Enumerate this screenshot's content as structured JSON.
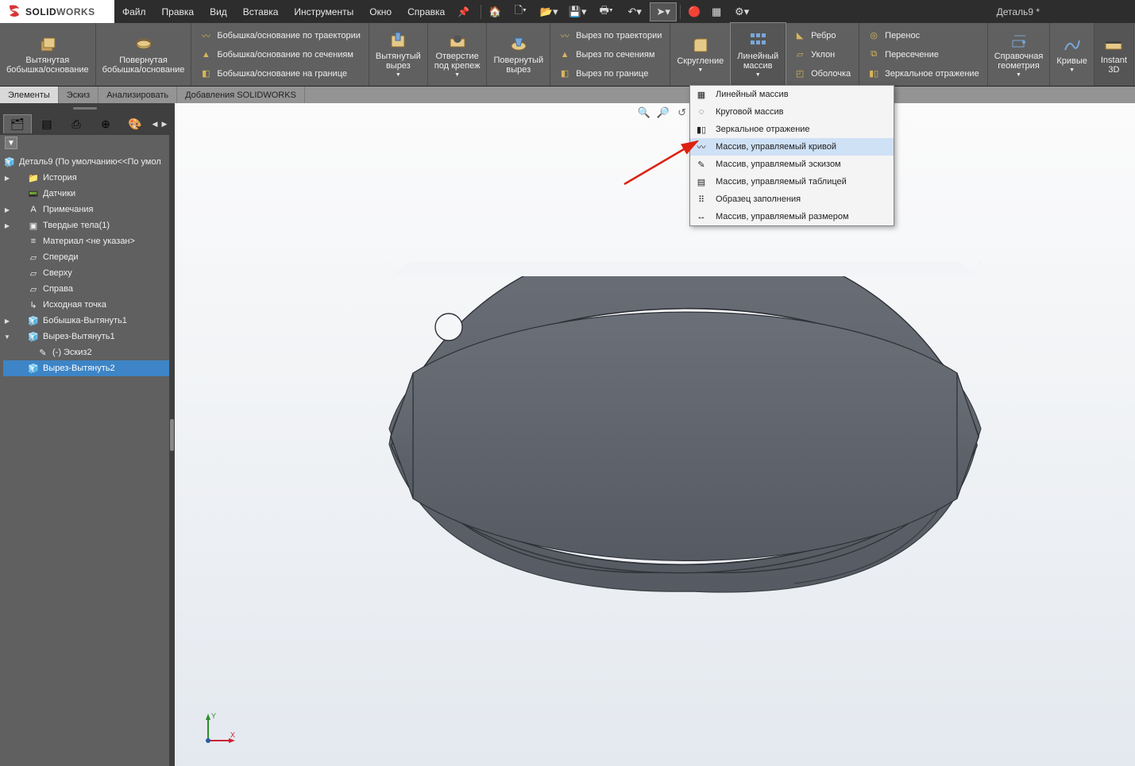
{
  "app": {
    "name_bold": "SOLID",
    "name_rest": "WORKS",
    "document": "Деталь9 *"
  },
  "menubar": {
    "items": [
      "Файл",
      "Правка",
      "Вид",
      "Вставка",
      "Инструменты",
      "Окно",
      "Справка"
    ]
  },
  "ribbon": {
    "extruded_boss": "Вытянутая\nбобышка/основание",
    "revolved_boss": "Повернутая\nбобышка/основание",
    "sweep_boss": "Бобышка/основание по траектории",
    "loft_boss": "Бобышка/основание по сечениям",
    "boundary_boss": "Бобышка/основание на границе",
    "extruded_cut": "Вытянутый\nвырез",
    "hole_wizard": "Отверстие\nпод крепеж",
    "revolved_cut": "Повернутый\nвырез",
    "sweep_cut": "Вырез по траектории",
    "loft_cut": "Вырез по сечениям",
    "boundary_cut": "Вырез по границе",
    "fillet": "Скругление",
    "linear_pattern": "Линейный\nмассив",
    "rib": "Ребро",
    "draft": "Уклон",
    "shell": "Оболочка",
    "wrap": "Перенос",
    "intersect": "Пересечение",
    "mirror": "Зеркальное отражение",
    "ref_geom": "Справочная\nгеометрия",
    "curves": "Кривые",
    "instant3d": "Instant\n3D"
  },
  "ribbontabs": {
    "items": [
      "Элементы",
      "Эскиз",
      "Анализировать",
      "Добавления SOLIDWORKS"
    ],
    "active": 0
  },
  "fmtree": {
    "root": "Деталь9  (По умолчанию<<По умол",
    "nodes": [
      {
        "exp": "▶",
        "indent": 1,
        "icon": "folder",
        "label": "История"
      },
      {
        "exp": "",
        "indent": 1,
        "icon": "sensor",
        "label": "Датчики"
      },
      {
        "exp": "▶",
        "indent": 1,
        "icon": "notes",
        "label": "Примечания"
      },
      {
        "exp": "▶",
        "indent": 1,
        "icon": "solids",
        "label": "Твердые тела(1)"
      },
      {
        "exp": "",
        "indent": 1,
        "icon": "material",
        "label": "Материал <не указан>"
      },
      {
        "exp": "",
        "indent": 1,
        "icon": "plane",
        "label": "Спереди"
      },
      {
        "exp": "",
        "indent": 1,
        "icon": "plane",
        "label": "Сверху"
      },
      {
        "exp": "",
        "indent": 1,
        "icon": "plane",
        "label": "Справа"
      },
      {
        "exp": "",
        "indent": 1,
        "icon": "origin",
        "label": "Исходная точка"
      },
      {
        "exp": "▶",
        "indent": 1,
        "icon": "feat",
        "label": "Бобышка-Вытянуть1"
      },
      {
        "exp": "▼",
        "indent": 1,
        "icon": "feat",
        "label": "Вырез-Вытянуть1"
      },
      {
        "exp": "",
        "indent": 2,
        "icon": "sketch",
        "label": "(-) Эскиз2"
      },
      {
        "exp": "",
        "indent": 1,
        "icon": "feat",
        "label": "Вырез-Вытянуть2",
        "selected": true
      }
    ]
  },
  "dropdown": {
    "items": [
      "Линейный массив",
      "Круговой массив",
      "Зеркальное отражение",
      "Массив, управляемый кривой",
      "Массив, управляемый эскизом",
      "Массив, управляемый таблицей",
      "Образец заполнения",
      "Массив, управляемый размером"
    ],
    "hover_index": 3
  },
  "triad": {
    "x": "X",
    "y": "Y"
  }
}
